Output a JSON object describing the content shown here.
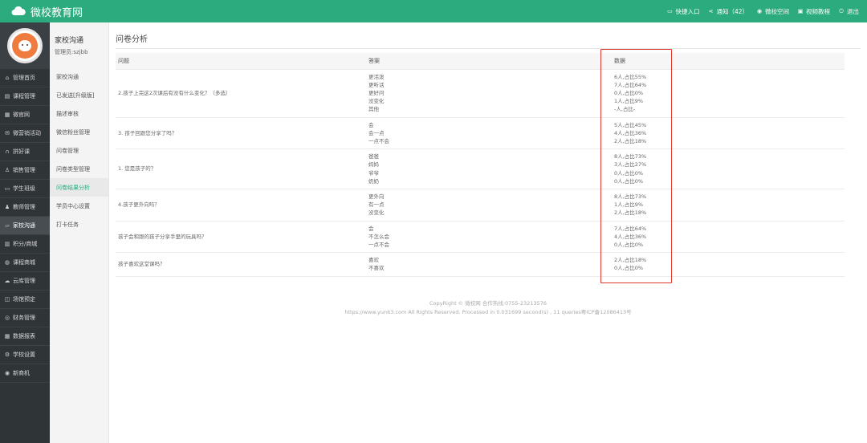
{
  "header": {
    "brand": "微校教育网",
    "actions": [
      {
        "icon": "computer-icon",
        "label": "快捷入口"
      },
      {
        "icon": "share-icon",
        "label": "通知（42）"
      },
      {
        "icon": "eye-icon",
        "label": "微校空间"
      },
      {
        "icon": "video-icon",
        "label": "视频教程"
      },
      {
        "icon": "power-icon",
        "label": "退出"
      }
    ]
  },
  "sidebar": {
    "items": [
      {
        "icon": "home-icon",
        "label": "管理首页"
      },
      {
        "icon": "book-icon",
        "label": "课程管理"
      },
      {
        "icon": "grid-icon",
        "label": "微官网"
      },
      {
        "icon": "gift-icon",
        "label": "微营销活动"
      },
      {
        "icon": "headset-icon",
        "label": "拼好课"
      },
      {
        "icon": "user-icon",
        "label": "销售管理"
      },
      {
        "icon": "card-icon",
        "label": "学生班级"
      },
      {
        "icon": "teacher-icon",
        "label": "教师管理"
      },
      {
        "icon": "chat-icon",
        "label": "家校沟通"
      },
      {
        "icon": "points-icon",
        "label": "积分/商城"
      },
      {
        "icon": "shop-icon",
        "label": "课程商城"
      },
      {
        "icon": "cloud-icon",
        "label": "云库管理"
      },
      {
        "icon": "venue-icon",
        "label": "场馆预定"
      },
      {
        "icon": "money-icon",
        "label": "财务管理"
      },
      {
        "icon": "report-icon",
        "label": "数据报表"
      },
      {
        "icon": "settings-icon",
        "label": "学校设置"
      },
      {
        "icon": "machine-icon",
        "label": "新商机"
      }
    ],
    "active_index": 8
  },
  "subnav": {
    "title": "家校沟通",
    "admin": "管理员:szjbb",
    "items": [
      "家校沟通",
      "已发送[升级版]",
      "描述审核",
      "微信粉丝管理",
      "问卷管理",
      "问卷类型管理",
      "问卷结果分析",
      "学员中心设置",
      "打卡任务"
    ],
    "active_index": 6
  },
  "page": {
    "title": "问卷分析",
    "columns": [
      "问题",
      "答案",
      "数据"
    ],
    "rows": [
      {
        "question": "2.孩子上完这2次课后有没有什么变化？（多选）",
        "answers": [
          "更活泼",
          "更听话",
          "更好问",
          "没变化",
          "其他"
        ],
        "data": [
          "6人,占比55%",
          "7人,占比64%",
          "0人,占比0%",
          "1人,占比9%",
          "-人,占比-"
        ]
      },
      {
        "question": "3. 孩子回跟您分享了吗？",
        "answers": [
          "会",
          "会一点",
          "一点不会"
        ],
        "data": [
          "5人,占比45%",
          "4人,占比36%",
          "2人,占比18%"
        ]
      },
      {
        "question": "1. 您是孩子的？",
        "answers": [
          "爸爸",
          "妈妈",
          "爷爷",
          "奶奶"
        ],
        "data": [
          "8人,占比73%",
          "3人,占比27%",
          "0人,占比0%",
          "0人,占比0%"
        ]
      },
      {
        "question": "4.孩子更外向吗？",
        "answers": [
          "更外向",
          "有一点",
          "没变化"
        ],
        "data": [
          "8人,占比73%",
          "1人,占比9%",
          "2人,占比18%"
        ]
      },
      {
        "question": "孩子会和跟的孩子分享手里的玩具吗？",
        "answers": [
          "会",
          "不怎么会",
          "一点不会"
        ],
        "data": [
          "7人,占比64%",
          "4人,占比36%",
          "0人,占比0%"
        ]
      },
      {
        "question": "孩子喜欢这堂课吗？",
        "answers": [
          "喜欢",
          "不喜欢"
        ],
        "data": [
          "2人,占比18%",
          "0人,占比0%"
        ]
      }
    ]
  },
  "footer": {
    "line1": "CopyRight © 微校网 合作热线:0755-23213576",
    "line2": "https://www.yun63.com All Rights Reserved. Processed in 0.031699 second(s) , 11 queries粤ICP备12086413号"
  },
  "colors": {
    "brand": "#2bab7e",
    "sidebar": "#2f3437",
    "highlight": "#e03a2e"
  }
}
